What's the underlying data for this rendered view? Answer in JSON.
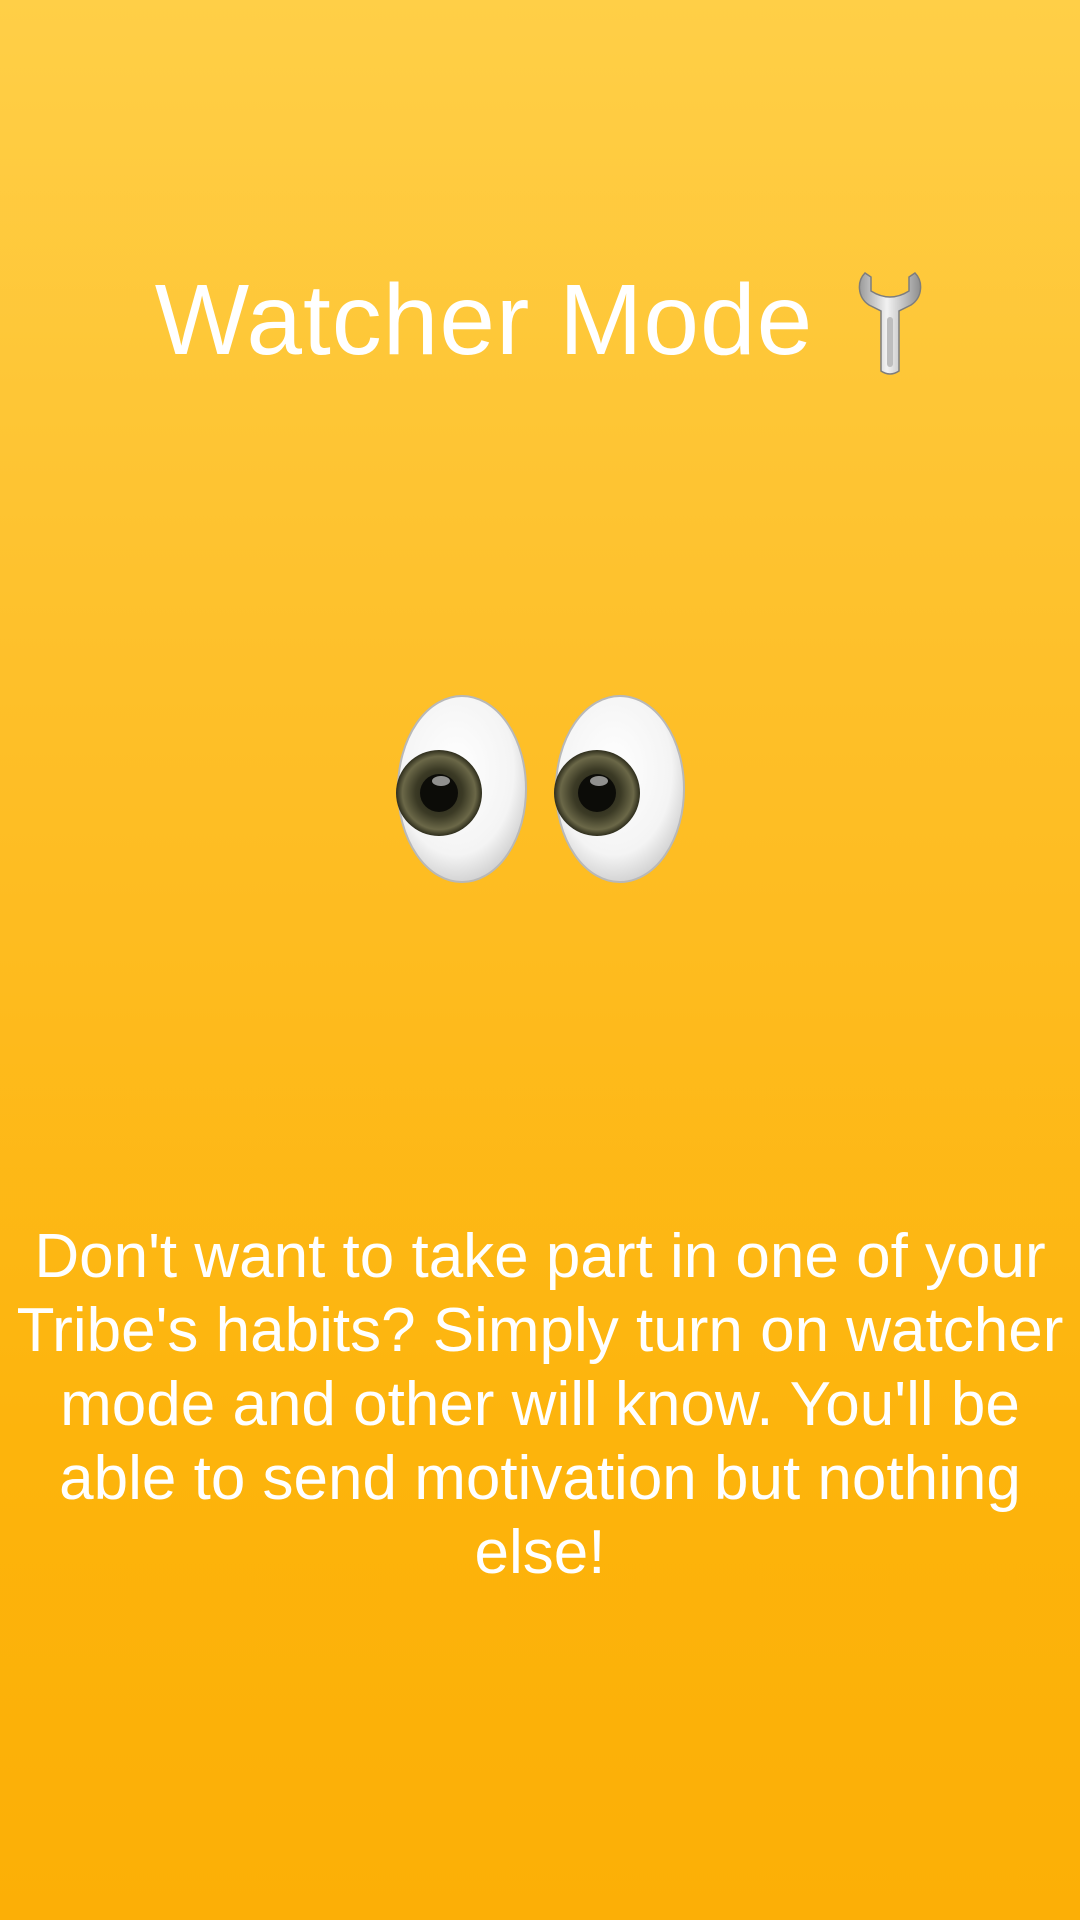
{
  "screen": {
    "title": "Watcher Mode",
    "title_icon": "wrench-icon",
    "illustration": "eyes-emoji",
    "message": "Don't want to take part in one of your Tribe's habits? Simply turn on watcher mode and other will know. You'll be able to send motivation but nothing else!"
  },
  "colors": {
    "background_top": "#FFCF47",
    "background_bottom": "#FCAF06",
    "text": "#FFFFFF"
  }
}
